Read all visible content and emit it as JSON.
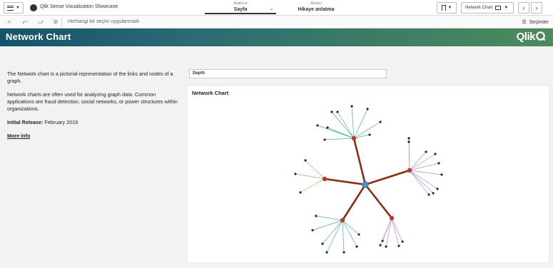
{
  "toolbar": {
    "app_title": "Qlik Sense Visualization Showcase",
    "analyze_small": "Analiz et",
    "analyze_label": "Sayfa",
    "story_small": "Anlatın",
    "story_label": "Hikaye anlatma",
    "sheet_button_label": "Network Chart"
  },
  "selection_bar": {
    "no_selection_text": "Herhangi bir seçim uygulanmadı",
    "selections_label": "Seçimler"
  },
  "header": {
    "title": "Network Chart",
    "logo_text": "Qlik"
  },
  "description": {
    "intro": "The Network chart is a pictorial representation of the links and nodes of a graph.",
    "uses": "Network charts are often used for analyzing graph data. Common applications are fraud detection, social networks, or power structures within organizations.",
    "release_label": "Initial Release:",
    "release_value": "February 2019",
    "more_info": "More Info"
  },
  "filter": {
    "value": "Depth"
  },
  "chart": {
    "title": "Network Chart",
    "colors": {
      "center": "#4a90d9",
      "hub": "#c0392b",
      "trunk_link": "#8b2a12",
      "leaf": "#1f2933"
    },
    "hubs": [
      {
        "name": "hub-top",
        "link_color": "#2f9e8f",
        "leaf_count": 9
      },
      {
        "name": "hub-right",
        "link_color": "#9b7fc8",
        "leaf_count": 9
      },
      {
        "name": "hub-bottom-right",
        "link_color": "#d56bb5",
        "leaf_count": 5
      },
      {
        "name": "hub-bottom-left",
        "link_color": "#2aa09a",
        "leaf_count": 7
      },
      {
        "name": "hub-left",
        "link_color": "#7db85a",
        "leaf_count": 3
      }
    ]
  }
}
